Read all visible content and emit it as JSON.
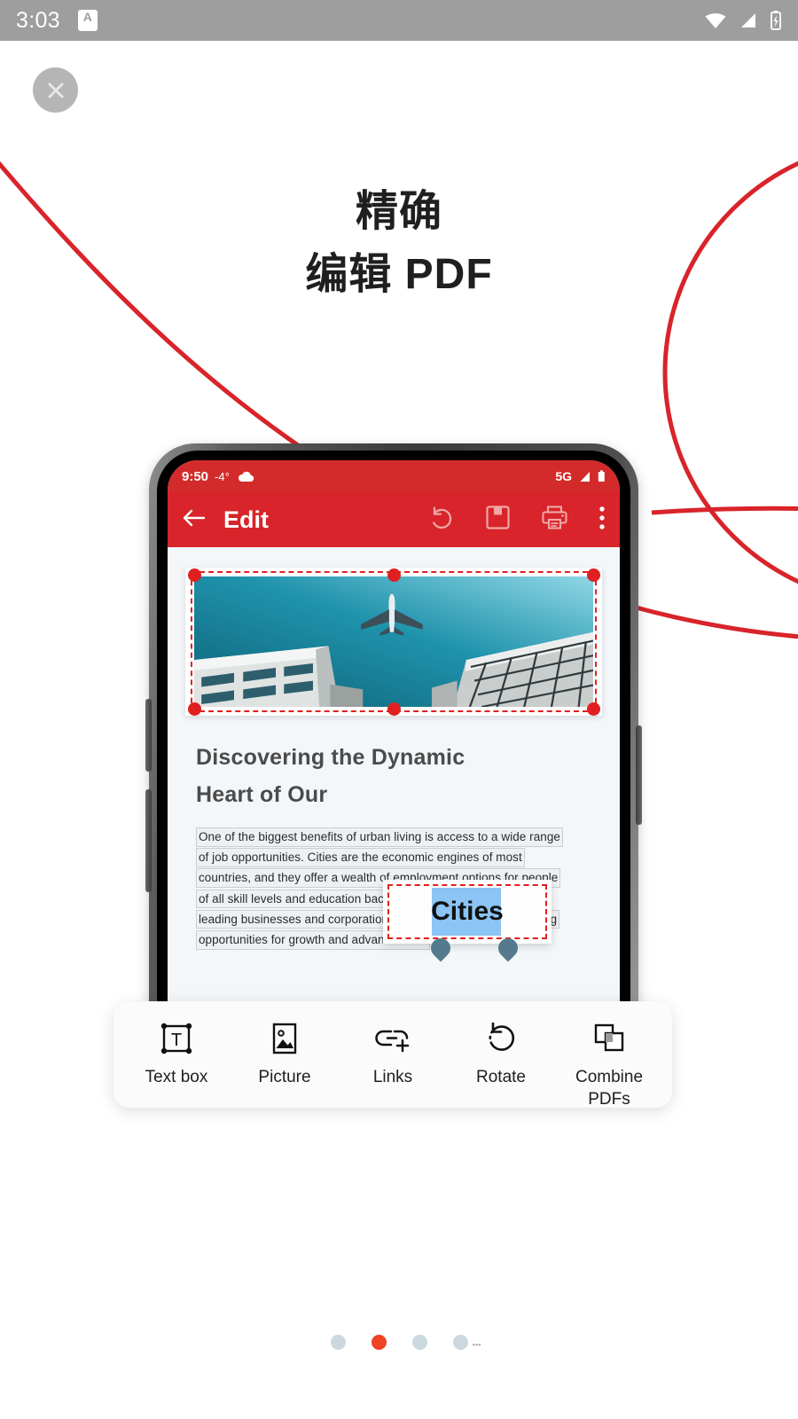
{
  "system_status_bar": {
    "time": "3:03",
    "badge_letter": "A",
    "icons": [
      "wifi-icon",
      "cellular-signal-icon",
      "battery-charging-icon"
    ]
  },
  "close_button": {
    "icon": "close-icon",
    "label": ""
  },
  "onboarding": {
    "headline_line1": "精确",
    "headline_line2": "编辑 PDF",
    "accent_color": "#d8242a"
  },
  "phone": {
    "status_bar": {
      "time": "9:50",
      "temperature": "-4°",
      "weather_icon": "cloud-icon",
      "network": "5G",
      "icons": [
        "cellular-signal-icon",
        "battery-icon"
      ]
    },
    "app_bar": {
      "back_icon": "back-arrow-icon",
      "title": "Edit",
      "actions": [
        {
          "name": "undo-icon",
          "label": "Undo"
        },
        {
          "name": "save-icon",
          "label": "Save"
        },
        {
          "name": "print-icon",
          "label": "Print"
        },
        {
          "name": "more-vertical-icon",
          "label": "More options"
        }
      ]
    },
    "document": {
      "image_alt": "Airplane flying above two modern buildings against a teal sky",
      "image_selected": true,
      "heading_line1": "Discovering the Dynamic",
      "heading_line2": "Heart of Our",
      "selected_text_box": {
        "value": "Cities",
        "selection_highlight_color": "#8cc4f5",
        "border_color": "#e02020"
      },
      "body_lines": [
        "One of the biggest benefits of urban living is access to a wide range",
        "of job opportunities. Cities are the economic engines of most",
        "countries, and they offer a wealth of employment options for people",
        "of all skill levels and education backgrounds. Many of the world's",
        "leading businesses and corporations are located in cities, providing",
        "opportunities for growth and advancement."
      ]
    }
  },
  "toolbar": {
    "items": [
      {
        "icon": "text-box-icon",
        "label": "Text box"
      },
      {
        "icon": "picture-icon",
        "label": "Picture"
      },
      {
        "icon": "links-icon",
        "label": "Links"
      },
      {
        "icon": "rotate-icon",
        "label": "Rotate"
      },
      {
        "icon": "combine-pdfs-icon",
        "label": "Combine PDFs"
      }
    ]
  },
  "pagination": {
    "total": 4,
    "active_index": 1,
    "active_color": "#ef4323",
    "inactive_color": "#ccd8e0"
  }
}
